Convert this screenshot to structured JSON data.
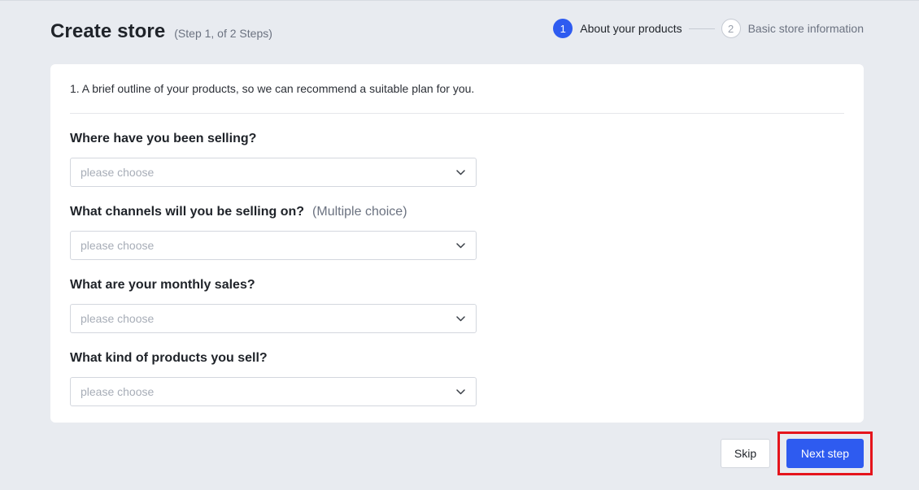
{
  "header": {
    "title": "Create store",
    "step_note": "(Step 1, of 2 Steps)"
  },
  "stepper": {
    "steps": [
      {
        "number": "1",
        "label": "About your products",
        "state": "active"
      },
      {
        "number": "2",
        "label": "Basic store information",
        "state": "inactive"
      }
    ]
  },
  "form": {
    "intro": "1. A brief outline of your products, so we can recommend a suitable plan for you.",
    "questions": [
      {
        "label": "Where have you been selling?",
        "note": "",
        "placeholder": "please choose"
      },
      {
        "label": "What channels will you be selling on?",
        "note": "(Multiple choice)",
        "placeholder": "please choose"
      },
      {
        "label": "What are your monthly sales?",
        "note": "",
        "placeholder": "please choose"
      },
      {
        "label": "What kind of products you sell?",
        "note": "",
        "placeholder": "please choose"
      }
    ]
  },
  "actions": {
    "skip_label": "Skip",
    "next_label": "Next step"
  },
  "icons": {
    "dropdown": "chevron-down-icon"
  },
  "colors": {
    "accent": "#2e5bf0",
    "background": "#e8ebf0",
    "highlight": "#e5141c"
  }
}
